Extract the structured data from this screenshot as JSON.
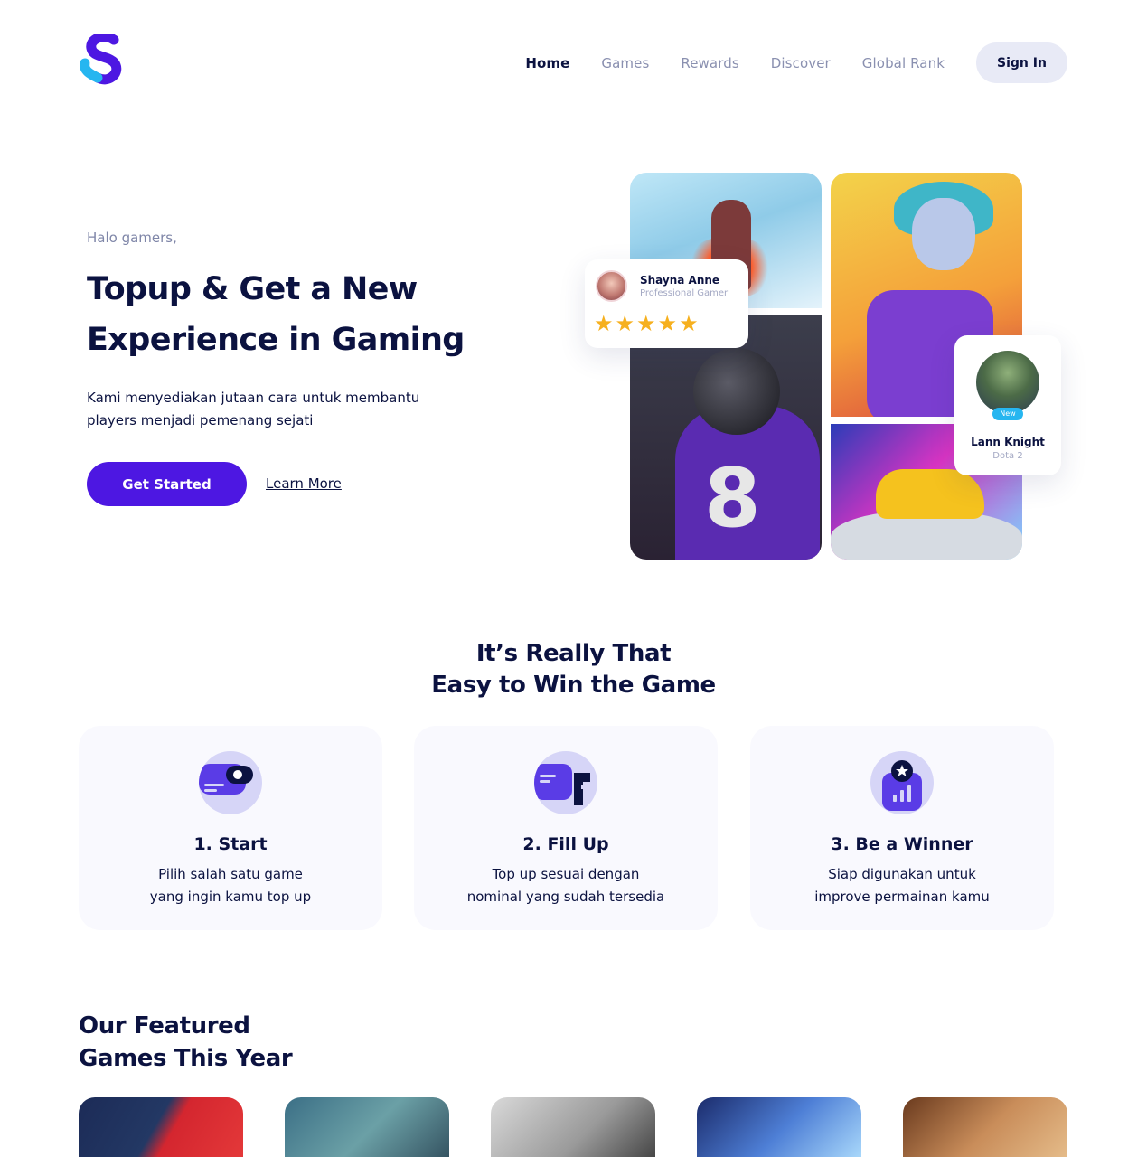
{
  "nav": {
    "items": [
      {
        "label": "Home",
        "active": true
      },
      {
        "label": "Games",
        "active": false
      },
      {
        "label": "Rewards",
        "active": false
      },
      {
        "label": "Discover",
        "active": false
      },
      {
        "label": "Global Rank",
        "active": false
      }
    ],
    "signin_label": "Sign In"
  },
  "hero": {
    "greeting": "Halo gamers,",
    "title_part1": "Topup & Get a ",
    "title_highlight1": "New",
    "title_highlight2": "Experience",
    "title_part2": " in Gaming",
    "desc_line1": "Kami menyediakan jutaan cara untuk membantu",
    "desc_line2": "players menjadi pemenang sejati",
    "cta_label": "Get Started",
    "learn_label": "Learn More"
  },
  "testimonial": {
    "name": "Shayna Anne",
    "role": "Professional Gamer",
    "stars": "★★★★★",
    "rating": 5
  },
  "player": {
    "badge": "New",
    "name": "Lann Knight",
    "game": "Dota 2"
  },
  "steps": {
    "title_line1": "It’s Really That",
    "title_line2": "Easy to Win the Game",
    "items": [
      {
        "title": "1. Start",
        "line1": "Pilih salah satu game",
        "line2": "yang ingin kamu top up",
        "icon": "game-controller-icon"
      },
      {
        "title": "2. Fill Up",
        "line1": "Top up sesuai dengan",
        "line2": "nominal yang sudah tersedia",
        "icon": "wallet-icon"
      },
      {
        "title": "3. Be a Winner",
        "line1": "Siap digunakan untuk",
        "line2": "improve permainan kamu",
        "icon": "trophy-badge-icon"
      }
    ]
  },
  "featured": {
    "title_line1": "Our Featured",
    "title_line2": "Games This Year"
  },
  "colors": {
    "primary": "#4d17e2",
    "navy": "#0b1240",
    "accent": "#26b6f0",
    "muted": "#8a90b0",
    "star": "#f6b01e",
    "icon_bg": "#d6d5f7"
  }
}
